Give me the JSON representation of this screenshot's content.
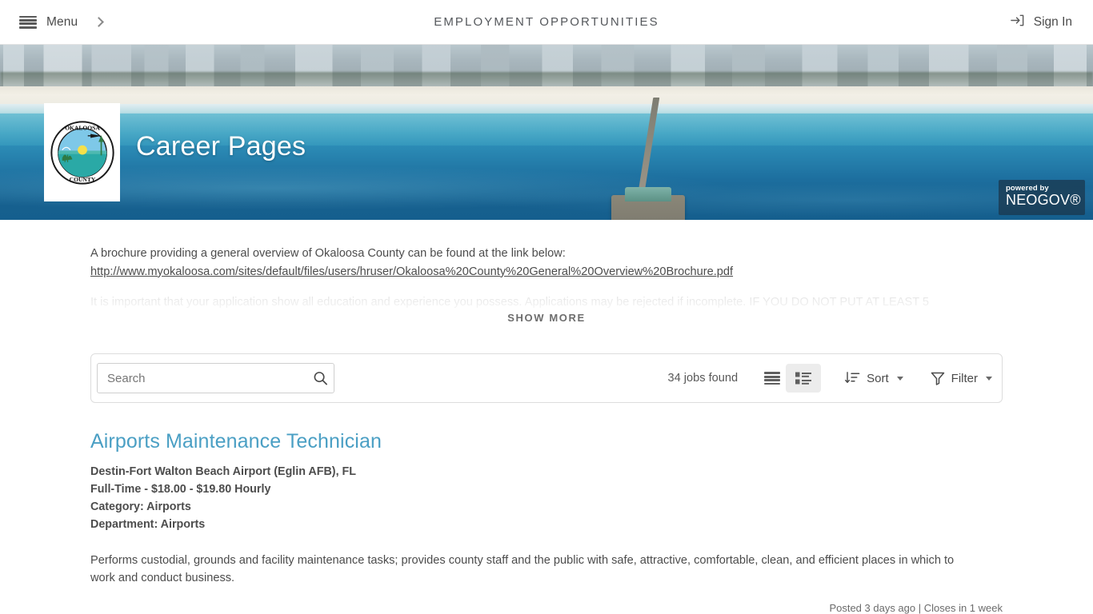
{
  "nav": {
    "menu_label": "Menu",
    "title": "EMPLOYMENT OPPORTUNITIES",
    "signin_label": "Sign In",
    "menu_icon": "hamburger-icon",
    "chevron_icon": "chevron-right-icon",
    "signin_icon": "sign-in-icon"
  },
  "hero": {
    "title": "Career Pages",
    "logo_alt": "Okaloosa County seal",
    "badge_powered": "powered by",
    "badge_brand": "NEOGOV®"
  },
  "intro": {
    "line1": "A brochure providing a general overview of Okaloosa County can be found at the link below:",
    "link": "http://www.myokaloosa.com/sites/default/files/users/hruser/Okaloosa%20County%20General%20Overview%20Brochure.pdf",
    "clamped": "It is important that your application show all education and experience you possess. Applications may be rejected if incomplete. IF YOU DO NOT PUT AT LEAST 5",
    "show_more": "SHOW MORE"
  },
  "toolbar": {
    "search_placeholder": "Search",
    "search_value": "",
    "search_icon": "search-icon",
    "jobs_found": "34 jobs found",
    "list_view_icon": "list-view-icon",
    "grid_view_icon": "grid-view-icon",
    "sort_label": "Sort",
    "sort_icon": "sort-descending-icon",
    "filter_label": "Filter",
    "filter_icon": "funnel-icon"
  },
  "jobs": [
    {
      "title": "Airports Maintenance Technician",
      "location": "Destin-Fort Walton Beach Airport (Eglin AFB), FL",
      "type_salary": "Full-Time - $18.00 - $19.80 Hourly",
      "category": "Category: Airports",
      "department": "Department: Airports",
      "description": "Performs custodial, grounds and facility maintenance tasks; provides county staff and the public with safe, attractive, comfortable, clean, and efficient places in which to work and conduct business.",
      "posted": "Posted 3 days ago | Closes in 1 week"
    }
  ],
  "colors": {
    "job_title": "#4a9fc4",
    "text": "#4c4c4c",
    "border": "#dddddd",
    "active_view_bg": "#ececec"
  }
}
